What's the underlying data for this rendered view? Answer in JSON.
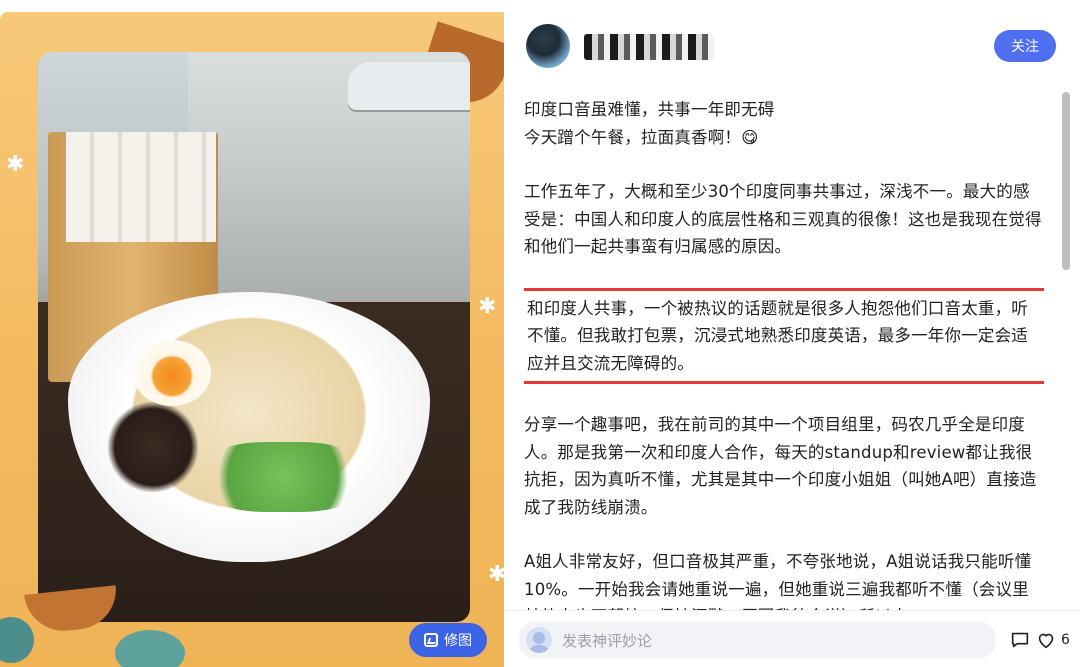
{
  "left_panel": {
    "edit_button_label": "修图"
  },
  "header": {
    "username": "",
    "follow_label": "关注"
  },
  "post": {
    "paragraphs": [
      "印度口音虽难懂，共事一年即无碍\n今天蹭个午餐，拉面真香啊！😋",
      "工作五年了，大概和至少30个印度同事共事过，深浅不一。最大的感受是：中国人和印度人的底层性格和三观真的很像！这也是我现在觉得和他们一起共事蛮有归属感的原因。",
      "和印度人共事，一个被热议的话题就是很多人抱怨他们口音太重，听不懂。但我敢打包票，沉浸式地熟悉印度英语，最多一年你一定会适应并且交流无障碍的。",
      "分享一个趣事吧，我在前司的其中一个项目组里，码农几乎全是印度人。那是我第一次和印度人合作，每天的standup和review都让我很抗拒，因为真听不懂，尤其是其中一个印度小姐姐（叫她A吧）直接造成了我防线崩溃。",
      "A姐人非常友好，但口音极其严重，不夸张地说，A姐说话我只能听懂10%。一开始我会请她重说一遍，但她重说三遍我都听不懂（会议里其他人也不帮忙，保持沉默，原因我待会说）所以大"
    ],
    "highlighted_paragraph_index": 2
  },
  "footer": {
    "comment_placeholder": "发表神评妙论",
    "like_count": "6"
  },
  "colors": {
    "accent": "#4f6ff1",
    "edit_button": "#3b63e6",
    "highlight_border": "#e53935"
  },
  "icons": [
    "comment-icon",
    "heart-icon",
    "image-edit-icon",
    "user-avatar-icon"
  ]
}
